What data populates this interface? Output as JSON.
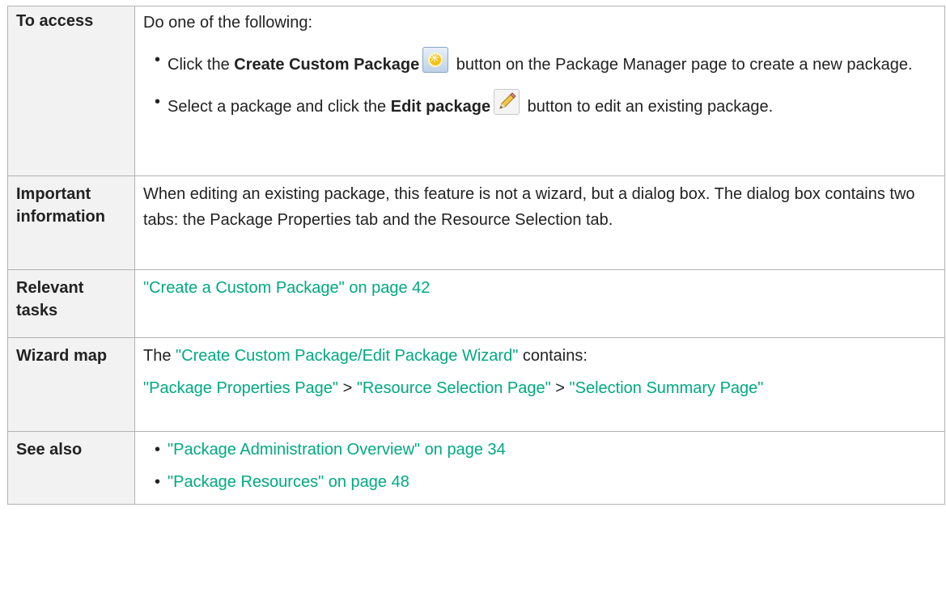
{
  "rows": {
    "to_access": {
      "label": "To access",
      "intro": "Do one of the following:",
      "bullet1": {
        "pre": "Click the ",
        "bold": "Create Custom Package",
        "icon": "create-custom-package-icon",
        "post": " button on the Package Manager page to create a new package."
      },
      "bullet2": {
        "pre": "Select a package and click the ",
        "bold": "Edit package",
        "icon": "edit-package-icon",
        "post": " button to edit an existing package."
      }
    },
    "important": {
      "label": "Important information",
      "text": "When editing an existing package, this feature is not a wizard, but a dialog box. The dialog box contains two tabs: the Package Properties tab and the Resource Selection tab."
    },
    "tasks": {
      "label": "Relevant tasks",
      "link": "\"Create a Custom Package\" on page 42"
    },
    "wizard": {
      "label": "Wizard map",
      "line1_pre": "The ",
      "line1_link": "\"Create Custom Package/Edit Package Wizard\"",
      "line1_post": " contains:",
      "link_a": "\"Package Properties Page\"",
      "sep1": " > ",
      "link_b": "\"Resource Selection Page\"",
      "sep2": " > ",
      "link_c": "\"Selection Summary Page\""
    },
    "see_also": {
      "label": "See also",
      "link1": "\"Package Administration Overview\" on page 34",
      "link2": "\"Package Resources\" on page 48"
    }
  },
  "colors": {
    "link": "#01a982",
    "label_bg": "#f2f2f2",
    "border": "#b3b3b3"
  }
}
